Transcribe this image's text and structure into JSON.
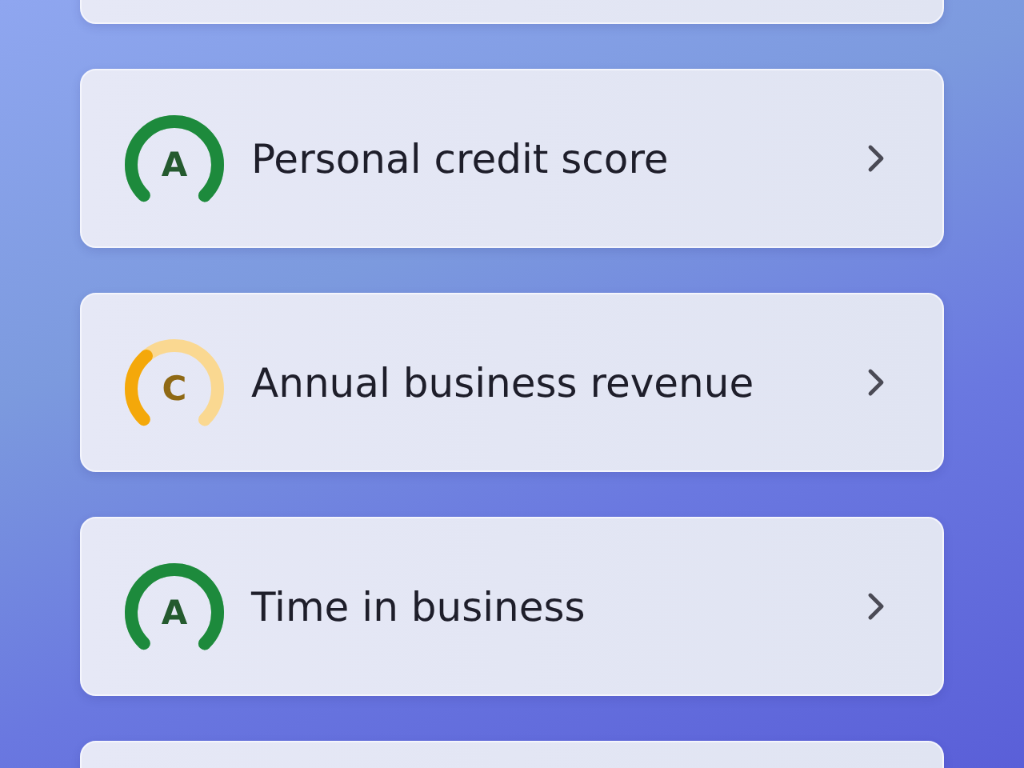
{
  "cards": [
    {
      "kind": "blank"
    },
    {
      "kind": "score",
      "grade": "A",
      "label": "Personal credit score",
      "color": "#1d8a3c"
    },
    {
      "kind": "score",
      "grade": "C",
      "label": "Annual business revenue",
      "color": "#f4a80a"
    },
    {
      "kind": "score",
      "grade": "A",
      "label": "Time in business",
      "color": "#1d8a3c"
    },
    {
      "kind": "blank"
    }
  ]
}
